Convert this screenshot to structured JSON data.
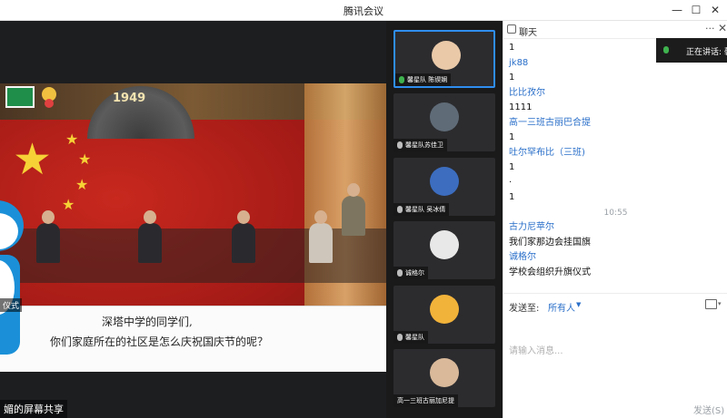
{
  "window": {
    "title": "腾讯会议",
    "minimize": "—",
    "maximize": "☐",
    "close": "✕"
  },
  "share": {
    "emblem_text": "1949",
    "caption_line1": "深塔中学的同学们,",
    "caption_line2": "你们家庭所在的社区是怎么庆祝国庆节的呢？",
    "side_label": "仪式",
    "share_label": "媚的屏幕共享"
  },
  "gallery": {
    "participants": [
      {
        "name": "馨星队 陈锲娴",
        "mic": "on",
        "active": true,
        "avatar_color": "#e9c9a8"
      },
      {
        "name": "馨星队苏佳卫",
        "mic": "off",
        "active": false,
        "avatar_color": "#5f6b77"
      },
      {
        "name": "馨星队 吴冰倩",
        "mic": "off",
        "active": false,
        "avatar_color": "#3c6dbf"
      },
      {
        "name": "诚格尔",
        "mic": "off",
        "active": false,
        "avatar_color": "#e8e8e8"
      },
      {
        "name": "馨星队",
        "mic": "off",
        "active": false,
        "avatar_color": "#f2b33a"
      },
      {
        "name": "高一三班古丽加尼提",
        "mic": "off",
        "active": false,
        "avatar_color": "#d9b99a"
      }
    ]
  },
  "chat": {
    "title": "聊天",
    "more": "···",
    "close": "✕",
    "speaking_label": "正在讲话: 馨",
    "messages": [
      {
        "type": "text",
        "text": "1"
      },
      {
        "type": "name",
        "text": "jk88"
      },
      {
        "type": "text",
        "text": "1"
      },
      {
        "type": "name",
        "text": "比比孜尔"
      },
      {
        "type": "text",
        "text": "1111"
      },
      {
        "type": "name",
        "text": "高一三班古丽巴合提"
      },
      {
        "type": "text",
        "text": "1"
      },
      {
        "type": "name",
        "text": "吐尔罕布比（三班)"
      },
      {
        "type": "text",
        "text": "1"
      },
      {
        "type": "text",
        "text": "·"
      },
      {
        "type": "text",
        "text": "1"
      },
      {
        "type": "time",
        "text": "10:55"
      },
      {
        "type": "name",
        "text": "古力尼苹尔"
      },
      {
        "type": "text",
        "text": "我们家那边会挂国旗"
      },
      {
        "type": "name",
        "text": "诚格尔"
      },
      {
        "type": "text",
        "text": "学校会组织升旗仪式"
      }
    ],
    "send_to_label": "发送至:",
    "send_target": "所有人",
    "caret": "▼",
    "file_caret": "▾",
    "input_placeholder": "请输入消息...",
    "send_button": "发送(S)"
  },
  "colors": {
    "accent": "#2a6fc9",
    "active_border": "#2f8ef0",
    "mic_on": "#3fb34f"
  }
}
